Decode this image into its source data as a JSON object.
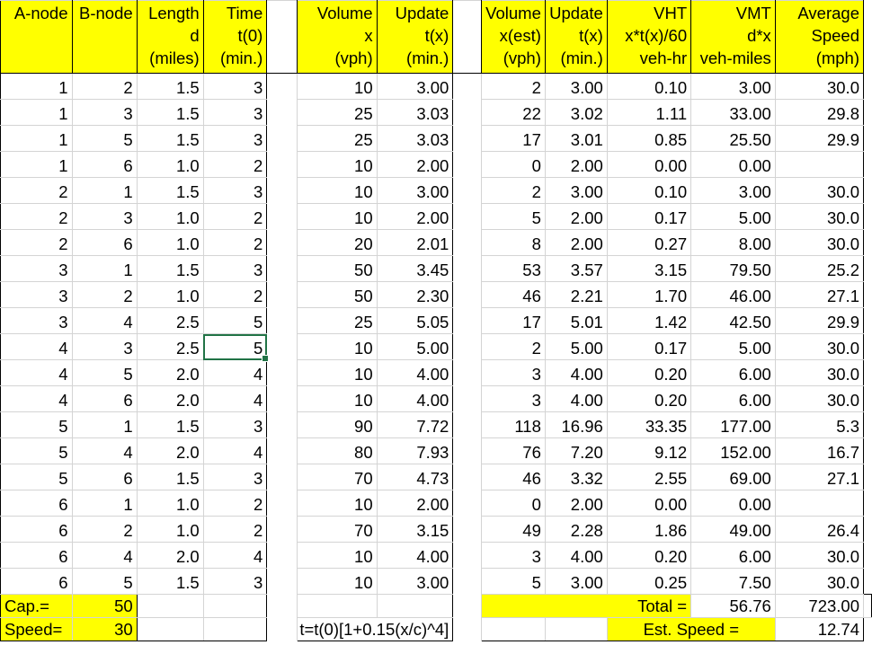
{
  "columns": {
    "a_node": "A-node",
    "b_node": "B-node",
    "length": [
      "Length",
      "d",
      "(miles)"
    ],
    "time": [
      "Time",
      "t(0)",
      "(min.)"
    ],
    "volume": [
      "Volume",
      "x",
      "(vph)"
    ],
    "update": [
      "Update",
      "t(x)",
      "(min.)"
    ],
    "volume_est": [
      "Volume",
      "x(est)",
      "(vph)"
    ],
    "update2": [
      "Update",
      "t(x)",
      "(min.)"
    ],
    "vht": [
      "VHT",
      "x*t(x)/60",
      "veh-hr"
    ],
    "vmt": [
      "VMT",
      "d*x",
      "veh-miles"
    ],
    "avg_speed": [
      "Average",
      "Speed",
      "(mph)"
    ]
  },
  "rows": [
    [
      "1",
      "2",
      "1.5",
      "3",
      "10",
      "3.00",
      "2",
      "3.00",
      "0.10",
      "3.00",
      "30.0"
    ],
    [
      "1",
      "3",
      "1.5",
      "3",
      "25",
      "3.03",
      "22",
      "3.02",
      "1.11",
      "33.00",
      "29.8"
    ],
    [
      "1",
      "5",
      "1.5",
      "3",
      "25",
      "3.03",
      "17",
      "3.01",
      "0.85",
      "25.50",
      "29.9"
    ],
    [
      "1",
      "6",
      "1.0",
      "2",
      "10",
      "2.00",
      "0",
      "2.00",
      "0.00",
      "0.00",
      ""
    ],
    [
      "2",
      "1",
      "1.5",
      "3",
      "10",
      "3.00",
      "2",
      "3.00",
      "0.10",
      "3.00",
      "30.0"
    ],
    [
      "2",
      "3",
      "1.0",
      "2",
      "10",
      "2.00",
      "5",
      "2.00",
      "0.17",
      "5.00",
      "30.0"
    ],
    [
      "2",
      "6",
      "1.0",
      "2",
      "20",
      "2.01",
      "8",
      "2.00",
      "0.27",
      "8.00",
      "30.0"
    ],
    [
      "3",
      "1",
      "1.5",
      "3",
      "50",
      "3.45",
      "53",
      "3.57",
      "3.15",
      "79.50",
      "25.2"
    ],
    [
      "3",
      "2",
      "1.0",
      "2",
      "50",
      "2.30",
      "46",
      "2.21",
      "1.70",
      "46.00",
      "27.1"
    ],
    [
      "3",
      "4",
      "2.5",
      "5",
      "25",
      "5.05",
      "17",
      "5.01",
      "1.42",
      "42.50",
      "29.9"
    ],
    [
      "4",
      "3",
      "2.5",
      "5",
      "10",
      "5.00",
      "2",
      "5.00",
      "0.17",
      "5.00",
      "30.0"
    ],
    [
      "4",
      "5",
      "2.0",
      "4",
      "10",
      "4.00",
      "3",
      "4.00",
      "0.20",
      "6.00",
      "30.0"
    ],
    [
      "4",
      "6",
      "2.0",
      "4",
      "10",
      "4.00",
      "3",
      "4.00",
      "0.20",
      "6.00",
      "30.0"
    ],
    [
      "5",
      "1",
      "1.5",
      "3",
      "90",
      "7.72",
      "118",
      "16.96",
      "33.35",
      "177.00",
      "5.3"
    ],
    [
      "5",
      "4",
      "2.0",
      "4",
      "80",
      "7.93",
      "76",
      "7.20",
      "9.12",
      "152.00",
      "16.7"
    ],
    [
      "5",
      "6",
      "1.5",
      "3",
      "70",
      "4.73",
      "46",
      "3.32",
      "2.55",
      "69.00",
      "27.1"
    ],
    [
      "6",
      "1",
      "1.0",
      "2",
      "10",
      "2.00",
      "0",
      "2.00",
      "0.00",
      "0.00",
      ""
    ],
    [
      "6",
      "2",
      "1.0",
      "2",
      "70",
      "3.15",
      "49",
      "2.28",
      "1.86",
      "49.00",
      "26.4"
    ],
    [
      "6",
      "4",
      "2.0",
      "4",
      "10",
      "4.00",
      "3",
      "4.00",
      "0.20",
      "6.00",
      "30.0"
    ],
    [
      "6",
      "5",
      "1.5",
      "3",
      "10",
      "3.00",
      "5",
      "3.00",
      "0.25",
      "7.50",
      "30.0"
    ]
  ],
  "footer": {
    "cap_label": "Cap.=",
    "cap_value": "50",
    "speed_label": "Speed=",
    "speed_value": "30",
    "total_label": "Total =",
    "total_vht": "56.76",
    "total_vmt": "723.00",
    "formula": "t=t(0)[1+0.15(x/c)^4]",
    "est_speed_label": "Est. Speed =",
    "est_speed_value": "12.74"
  },
  "selected_cell": {
    "row": 11,
    "column": "time"
  },
  "colors": {
    "header_fill": "#ffff00",
    "gridline": "#d4d4d4",
    "selection": "#217346"
  }
}
